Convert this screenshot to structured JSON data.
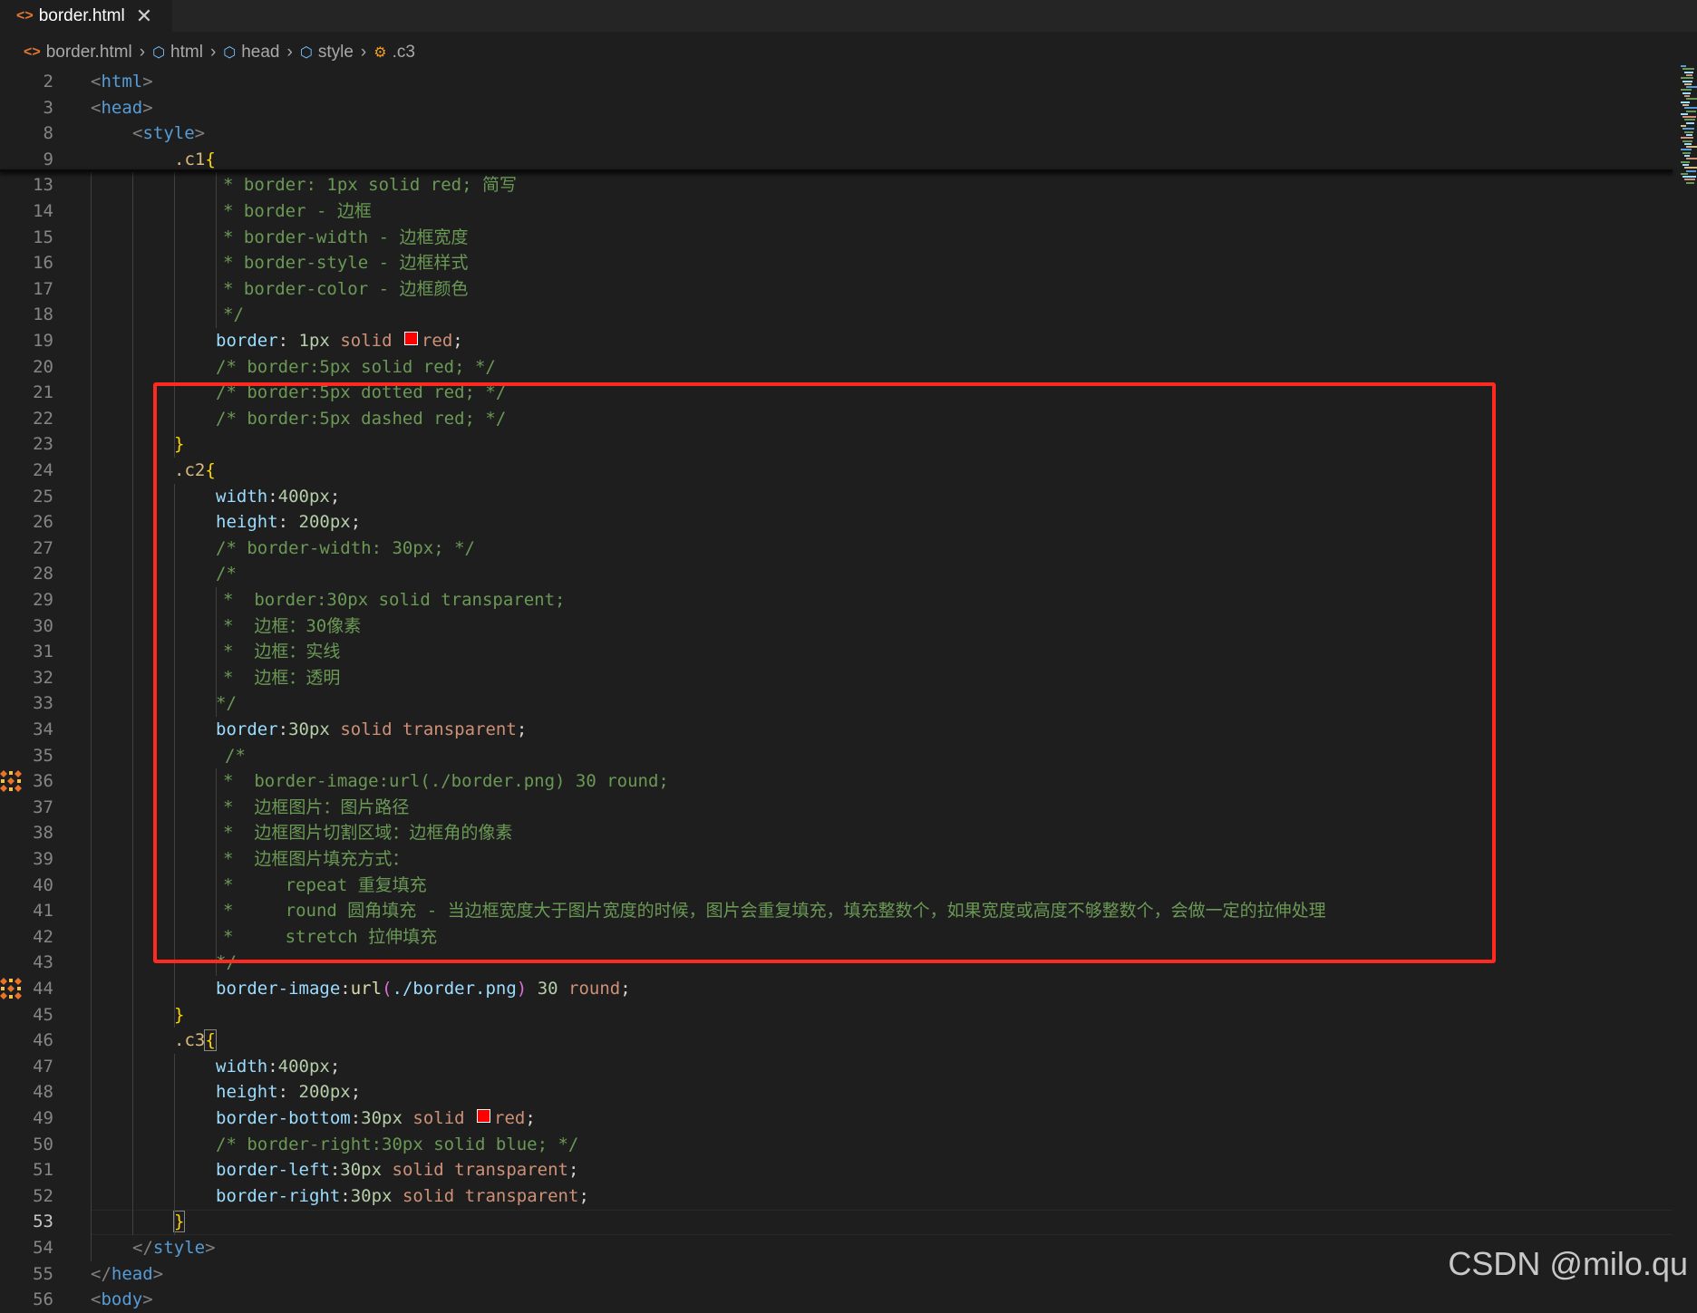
{
  "tab": {
    "title": "border.html",
    "close_glyph": "✕",
    "icon": "html-file-icon"
  },
  "breadcrumb": {
    "items": [
      {
        "label": "border.html",
        "icon": "html-file-icon"
      },
      {
        "label": "html",
        "icon": "element-cube-icon"
      },
      {
        "label": "head",
        "icon": "element-cube-icon"
      },
      {
        "label": "style",
        "icon": "element-cube-icon"
      },
      {
        "label": ".c3",
        "icon": "css-class-icon"
      }
    ]
  },
  "lines": [
    {
      "n": "2",
      "text": "<html>"
    },
    {
      "n": "3",
      "text": "<head>"
    },
    {
      "n": "8",
      "text": "<style>"
    },
    {
      "n": "9",
      "text": ".c1{"
    },
    {
      "n": "13",
      "text": "* border: 1px solid red; 简写"
    },
    {
      "n": "14",
      "text": "* border - 边框"
    },
    {
      "n": "15",
      "text": "* border-width - 边框宽度"
    },
    {
      "n": "16",
      "text": "* border-style - 边框样式"
    },
    {
      "n": "17",
      "text": "* border-color - 边框颜色"
    },
    {
      "n": "18",
      "text": "*/"
    },
    {
      "n": "19",
      "text": "border: 1px solid red;"
    },
    {
      "n": "20",
      "text": "/* border:5px solid red; */"
    },
    {
      "n": "21",
      "text": "/* border:5px dotted red; */"
    },
    {
      "n": "22",
      "text": "/* border:5px dashed red; */"
    },
    {
      "n": "23",
      "text": "}"
    },
    {
      "n": "24",
      "text": ".c2{"
    },
    {
      "n": "25",
      "text": "width:400px;"
    },
    {
      "n": "26",
      "text": "height: 200px;"
    },
    {
      "n": "27",
      "text": "/* border-width: 30px; */"
    },
    {
      "n": "28",
      "text": "/*"
    },
    {
      "n": "29",
      "text": "*  border:30px solid transparent;"
    },
    {
      "n": "30",
      "text": "*  边框：30像素"
    },
    {
      "n": "31",
      "text": "*  边框：实线"
    },
    {
      "n": "32",
      "text": "*  边框：透明"
    },
    {
      "n": "33",
      "text": "*/"
    },
    {
      "n": "34",
      "text": "border:30px solid transparent;"
    },
    {
      "n": "35",
      "text": "/*"
    },
    {
      "n": "36",
      "text": "*  border-image:url(./border.png) 30 round;"
    },
    {
      "n": "37",
      "text": "*  边框图片：图片路径"
    },
    {
      "n": "38",
      "text": "*  边框图片切割区域：边框角的像素"
    },
    {
      "n": "39",
      "text": "*  边框图片填充方式："
    },
    {
      "n": "40",
      "text": "*     repeat 重复填充"
    },
    {
      "n": "41",
      "text": "*     round 圆角填充 - 当边框宽度大于图片宽度的时候，图片会重复填充，填充整数个，如果宽度或高度不够整数个，会做一定的拉伸处理"
    },
    {
      "n": "42",
      "text": "*     stretch 拉伸填充"
    },
    {
      "n": "43",
      "text": "*/"
    },
    {
      "n": "44",
      "text": "border-image:url(./border.png) 30 round;"
    },
    {
      "n": "45",
      "text": "}"
    },
    {
      "n": "46",
      "text": ".c3{"
    },
    {
      "n": "47",
      "text": "width:400px;"
    },
    {
      "n": "48",
      "text": "height: 200px;"
    },
    {
      "n": "49",
      "text": "border-bottom:30px solid red;"
    },
    {
      "n": "50",
      "text": "/* border-right:30px solid blue; */"
    },
    {
      "n": "51",
      "text": "border-left:30px solid transparent;"
    },
    {
      "n": "52",
      "text": "border-right:30px solid transparent;"
    },
    {
      "n": "53",
      "text": "}"
    },
    {
      "n": "54",
      "text": "</style>"
    },
    {
      "n": "55",
      "text": "</head>"
    },
    {
      "n": "56",
      "text": "<body>"
    }
  ],
  "colors": {
    "highlight_box": "#ff2a1f",
    "swatch_red": "#ff0000"
  },
  "watermark": "CSDN @milo.qu"
}
